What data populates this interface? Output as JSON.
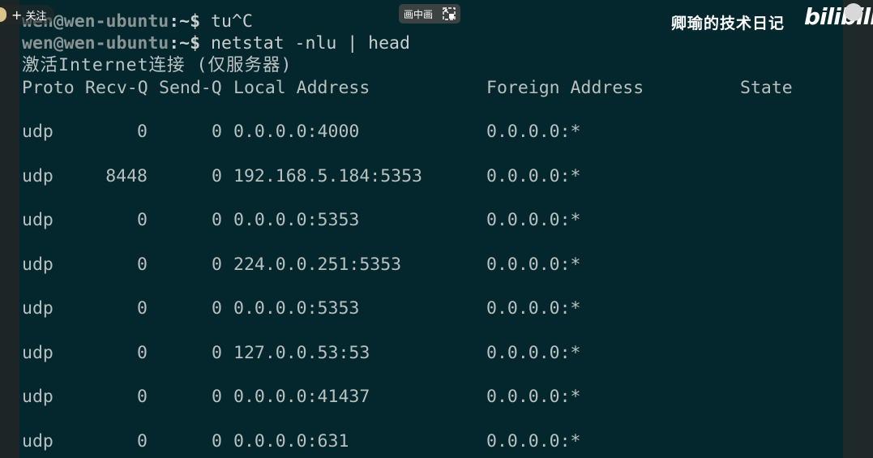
{
  "overlay": {
    "follow_label": "关注",
    "pip_label": "画中画",
    "watermark": "卿瑜的技术日记",
    "logo_text": "bilibili"
  },
  "terminal": {
    "prompt_user": "wen@wen-ubuntu",
    "prompt_suffix": ":~$ ",
    "history_command": "tu^C",
    "command": "netstat -nlu | head",
    "info_line": "激活Internet连接 (仅服务器)",
    "headers": {
      "proto": "Proto",
      "recvq": "Recv-Q",
      "sendq": "Send-Q",
      "local": "Local Address",
      "foreign": "Foreign Address",
      "state": "State"
    },
    "rows": [
      {
        "proto": "udp",
        "recvq": "0",
        "sendq": "0",
        "local": "0.0.0.0:4000",
        "foreign": "0.0.0.0:*"
      },
      {
        "proto": "udp",
        "recvq": "8448",
        "sendq": "0",
        "local": "192.168.5.184:5353",
        "foreign": "0.0.0.0:*"
      },
      {
        "proto": "udp",
        "recvq": "0",
        "sendq": "0",
        "local": "0.0.0.0:5353",
        "foreign": "0.0.0.0:*"
      },
      {
        "proto": "udp",
        "recvq": "0",
        "sendq": "0",
        "local": "224.0.0.251:5353",
        "foreign": "0.0.0.0:*"
      },
      {
        "proto": "udp",
        "recvq": "0",
        "sendq": "0",
        "local": "0.0.0.0:5353",
        "foreign": "0.0.0.0:*"
      },
      {
        "proto": "udp",
        "recvq": "0",
        "sendq": "0",
        "local": "127.0.0.53:53",
        "foreign": "0.0.0.0:*"
      },
      {
        "proto": "udp",
        "recvq": "0",
        "sendq": "0",
        "local": "0.0.0.0:41437",
        "foreign": "0.0.0.0:*"
      },
      {
        "proto": "udp",
        "recvq": "0",
        "sendq": "0",
        "local": "0.0.0.0:631",
        "foreign": "0.0.0.0:*"
      }
    ]
  }
}
